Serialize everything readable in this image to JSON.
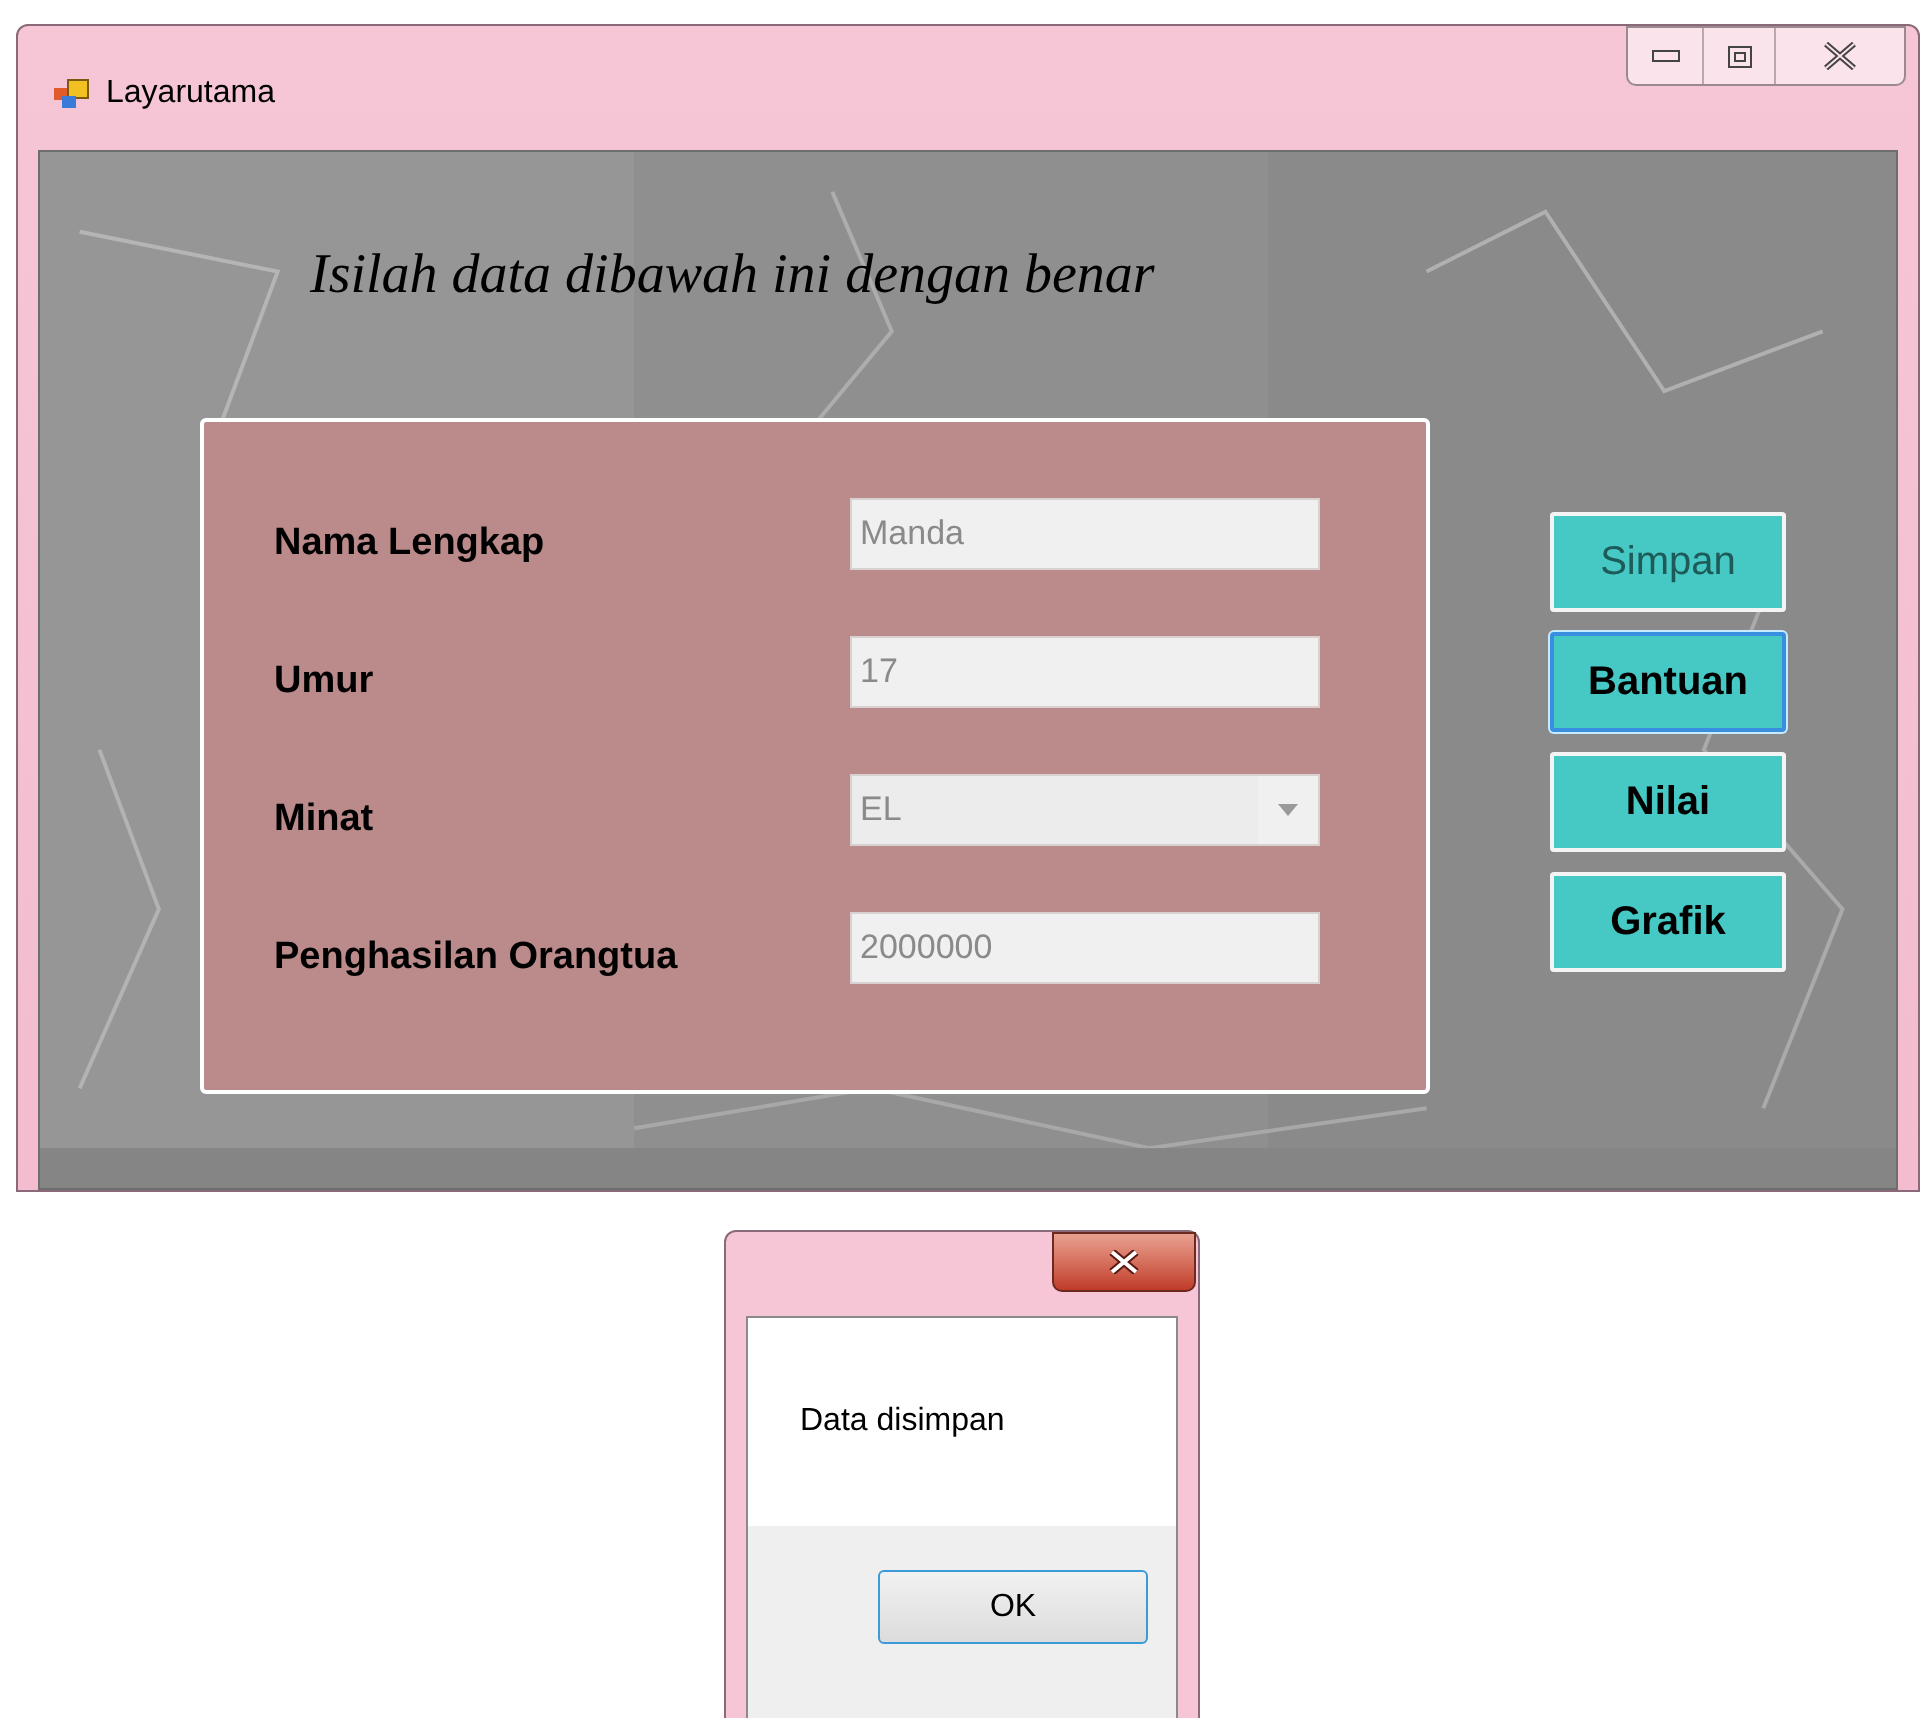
{
  "window": {
    "title": "Layarutama"
  },
  "heading": "Isilah data dibawah ini dengan benar",
  "fields": [
    {
      "kind": "text",
      "label": "Nama Lengkap",
      "value": "Manda",
      "disabled": true
    },
    {
      "kind": "text",
      "label": "Umur",
      "value": "17",
      "disabled": true
    },
    {
      "kind": "dropdown",
      "label": "Minat",
      "value": "EL",
      "disabled": true
    },
    {
      "kind": "text",
      "label": "Penghasilan Orangtua",
      "value": "2000000",
      "disabled": true
    }
  ],
  "buttons": [
    {
      "label": "Simpan",
      "bold": false,
      "focused": false
    },
    {
      "label": "Bantuan",
      "bold": true,
      "focused": true
    },
    {
      "label": "Nilai",
      "bold": true,
      "focused": false
    },
    {
      "label": "Grafik",
      "bold": true,
      "focused": false
    }
  ],
  "message_box": {
    "message": "Data disimpan",
    "button": "OK"
  }
}
